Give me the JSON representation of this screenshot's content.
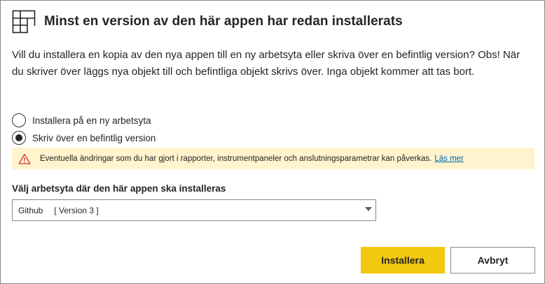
{
  "dialog": {
    "title": "Minst en version av den här appen har redan installerats",
    "icon": "app-grid-icon",
    "description": "Vill du installera en kopia av den nya appen till en ny arbetsyta eller skriva över en befintlig version? Obs! När du skriver över läggs nya objekt till och befintliga objekt skrivs över. Inga objekt kommer att tas bort."
  },
  "options": {
    "new_workspace_label": "Installera på en ny arbetsyta",
    "overwrite_label": "Skriv över en befintlig version",
    "selected": "overwrite"
  },
  "warning": {
    "icon": "warning-triangle-icon",
    "text": "Eventuella ändringar som du har gjort i rapporter, instrumentpaneler och anslutningsparametrar kan påverkas.",
    "link": "Läs mer",
    "background": "#fff4ce",
    "icon_color": "#d13438"
  },
  "workspace": {
    "label": "Välj arbetsyta där den här appen ska installeras",
    "selected_name": "Github",
    "selected_version": "[ Version 3 ]"
  },
  "buttons": {
    "install_label": "Installera",
    "cancel_label": "Avbryt",
    "install_color": "#f2c811"
  }
}
